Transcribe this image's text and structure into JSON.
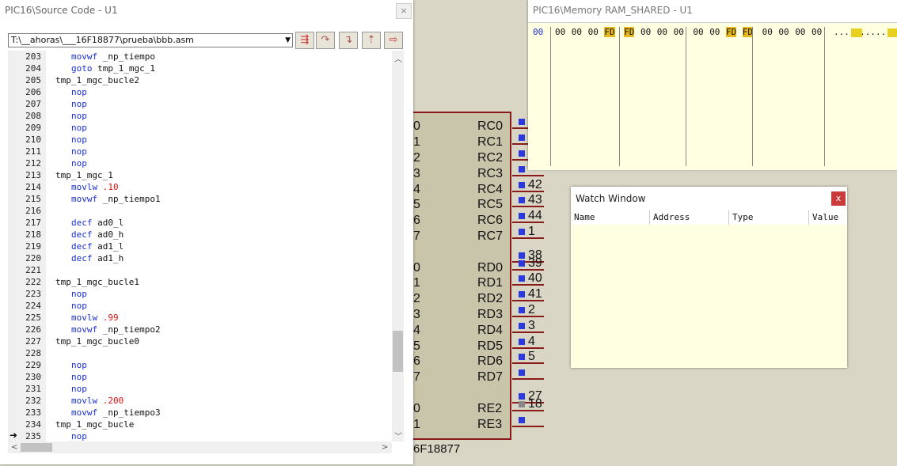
{
  "source_window": {
    "title": "PIC16\\Source Code - U1",
    "close": "×",
    "path": "T:\\__ahoras\\___16F18877\\prueba\\bbb.asm",
    "lines": [
      {
        "n": "203",
        "indent": true,
        "parts": [
          [
            "kw",
            "movwf"
          ],
          [
            "lbl",
            " _np_tiempo"
          ]
        ]
      },
      {
        "n": "204",
        "indent": true,
        "parts": [
          [
            "kw",
            "goto"
          ],
          [
            "lbl",
            " tmp_1_mgc_1"
          ]
        ]
      },
      {
        "n": "205",
        "indent": false,
        "parts": [
          [
            "lbl",
            "tmp_1_mgc_bucle2"
          ]
        ]
      },
      {
        "n": "206",
        "indent": true,
        "parts": [
          [
            "kw",
            "nop"
          ]
        ]
      },
      {
        "n": "207",
        "indent": true,
        "parts": [
          [
            "kw",
            "nop"
          ]
        ]
      },
      {
        "n": "208",
        "indent": true,
        "parts": [
          [
            "kw",
            "nop"
          ]
        ]
      },
      {
        "n": "209",
        "indent": true,
        "parts": [
          [
            "kw",
            "nop"
          ]
        ]
      },
      {
        "n": "210",
        "indent": true,
        "parts": [
          [
            "kw",
            "nop"
          ]
        ]
      },
      {
        "n": "211",
        "indent": true,
        "parts": [
          [
            "kw",
            "nop"
          ]
        ]
      },
      {
        "n": "212",
        "indent": true,
        "parts": [
          [
            "kw",
            "nop"
          ]
        ]
      },
      {
        "n": "213",
        "indent": false,
        "parts": [
          [
            "lbl",
            "tmp_1_mgc_1"
          ]
        ]
      },
      {
        "n": "214",
        "indent": true,
        "parts": [
          [
            "kw",
            "movlw"
          ],
          [
            "num",
            " .10"
          ]
        ]
      },
      {
        "n": "215",
        "indent": true,
        "parts": [
          [
            "kw",
            "movwf"
          ],
          [
            "lbl",
            " _np_tiempo1"
          ]
        ]
      },
      {
        "n": "216",
        "indent": false,
        "parts": []
      },
      {
        "n": "217",
        "indent": true,
        "parts": [
          [
            "kw",
            "decf"
          ],
          [
            "lbl",
            " ad0_l"
          ]
        ]
      },
      {
        "n": "218",
        "indent": true,
        "parts": [
          [
            "kw",
            "decf"
          ],
          [
            "lbl",
            " ad0_h"
          ]
        ]
      },
      {
        "n": "219",
        "indent": true,
        "parts": [
          [
            "kw",
            "decf"
          ],
          [
            "lbl",
            " ad1_l"
          ]
        ]
      },
      {
        "n": "220",
        "indent": true,
        "parts": [
          [
            "kw",
            "decf"
          ],
          [
            "lbl",
            " ad1_h"
          ]
        ]
      },
      {
        "n": "221",
        "indent": false,
        "parts": []
      },
      {
        "n": "222",
        "indent": false,
        "parts": [
          [
            "lbl",
            "tmp_1_mgc_bucle1"
          ]
        ]
      },
      {
        "n": "223",
        "indent": true,
        "parts": [
          [
            "kw",
            "nop"
          ]
        ]
      },
      {
        "n": "224",
        "indent": true,
        "parts": [
          [
            "kw",
            "nop"
          ]
        ]
      },
      {
        "n": "225",
        "indent": true,
        "parts": [
          [
            "kw",
            "movlw"
          ],
          [
            "num",
            " .99"
          ]
        ]
      },
      {
        "n": "226",
        "indent": true,
        "parts": [
          [
            "kw",
            "movwf"
          ],
          [
            "lbl",
            " _np_tiempo2"
          ]
        ]
      },
      {
        "n": "227",
        "indent": false,
        "parts": [
          [
            "lbl",
            "tmp_1_mgc_bucle0"
          ]
        ]
      },
      {
        "n": "228",
        "indent": false,
        "parts": []
      },
      {
        "n": "229",
        "indent": true,
        "parts": [
          [
            "kw",
            "nop"
          ]
        ]
      },
      {
        "n": "230",
        "indent": true,
        "parts": [
          [
            "kw",
            "nop"
          ]
        ]
      },
      {
        "n": "231",
        "indent": true,
        "parts": [
          [
            "kw",
            "nop"
          ]
        ]
      },
      {
        "n": "232",
        "indent": true,
        "parts": [
          [
            "kw",
            "movlw"
          ],
          [
            "num",
            " .200"
          ]
        ]
      },
      {
        "n": "233",
        "indent": true,
        "parts": [
          [
            "kw",
            "movwf"
          ],
          [
            "lbl",
            " _np_tiempo3"
          ]
        ]
      },
      {
        "n": "234",
        "indent": false,
        "parts": [
          [
            "lbl",
            "tmp_1_mgc_bucle"
          ]
        ]
      },
      {
        "n": "235",
        "indent": true,
        "parts": [
          [
            "kw",
            "nop"
          ]
        ]
      }
    ],
    "current_line_marker": "➜"
  },
  "memory_window": {
    "title": "PIC16\\Memory RAM_SHARED - U1",
    "address": "00",
    "bytes": [
      "00",
      "00",
      "00",
      "FD",
      "FD",
      "00",
      "00",
      "00",
      "00",
      "00",
      "FD",
      "FD",
      "00",
      "00",
      "00",
      "00"
    ],
    "highlighted": [
      3,
      4,
      10,
      11
    ],
    "ascii": "..........."
  },
  "watch_window": {
    "title": "Watch Window",
    "close": "x",
    "columns": [
      "Name",
      "Address",
      "Type",
      "Value"
    ]
  },
  "schematic": {
    "part": "6F18877",
    "left_digits": [
      "0",
      "1",
      "2",
      "3",
      "4",
      "5",
      "6",
      "7",
      "0",
      "1",
      "2",
      "3",
      "4",
      "5",
      "6",
      "7",
      "0",
      "1"
    ],
    "pins": [
      {
        "label": "RC0",
        "num": ""
      },
      {
        "label": "RC1",
        "num": ""
      },
      {
        "label": "RC2",
        "num": ""
      },
      {
        "label": "RC3",
        "num": ""
      },
      {
        "label": "RC4",
        "num": "42"
      },
      {
        "label": "RC5",
        "num": "43"
      },
      {
        "label": "RC6",
        "num": "44"
      },
      {
        "label": "RC7",
        "num": "1"
      },
      {
        "label": "",
        "num": "38"
      },
      {
        "label": "RD0",
        "num": "39"
      },
      {
        "label": "RD1",
        "num": "40"
      },
      {
        "label": "RD2",
        "num": "41"
      },
      {
        "label": "RD3",
        "num": "2"
      },
      {
        "label": "RD4",
        "num": "3"
      },
      {
        "label": "RD5",
        "num": "4"
      },
      {
        "label": "RD6",
        "num": "5"
      },
      {
        "label": "RD7",
        "num": ""
      },
      {
        "label": "",
        "num": "27"
      },
      {
        "label": "RE2",
        "num": "18"
      },
      {
        "label": "RE3",
        "num": ""
      }
    ]
  }
}
